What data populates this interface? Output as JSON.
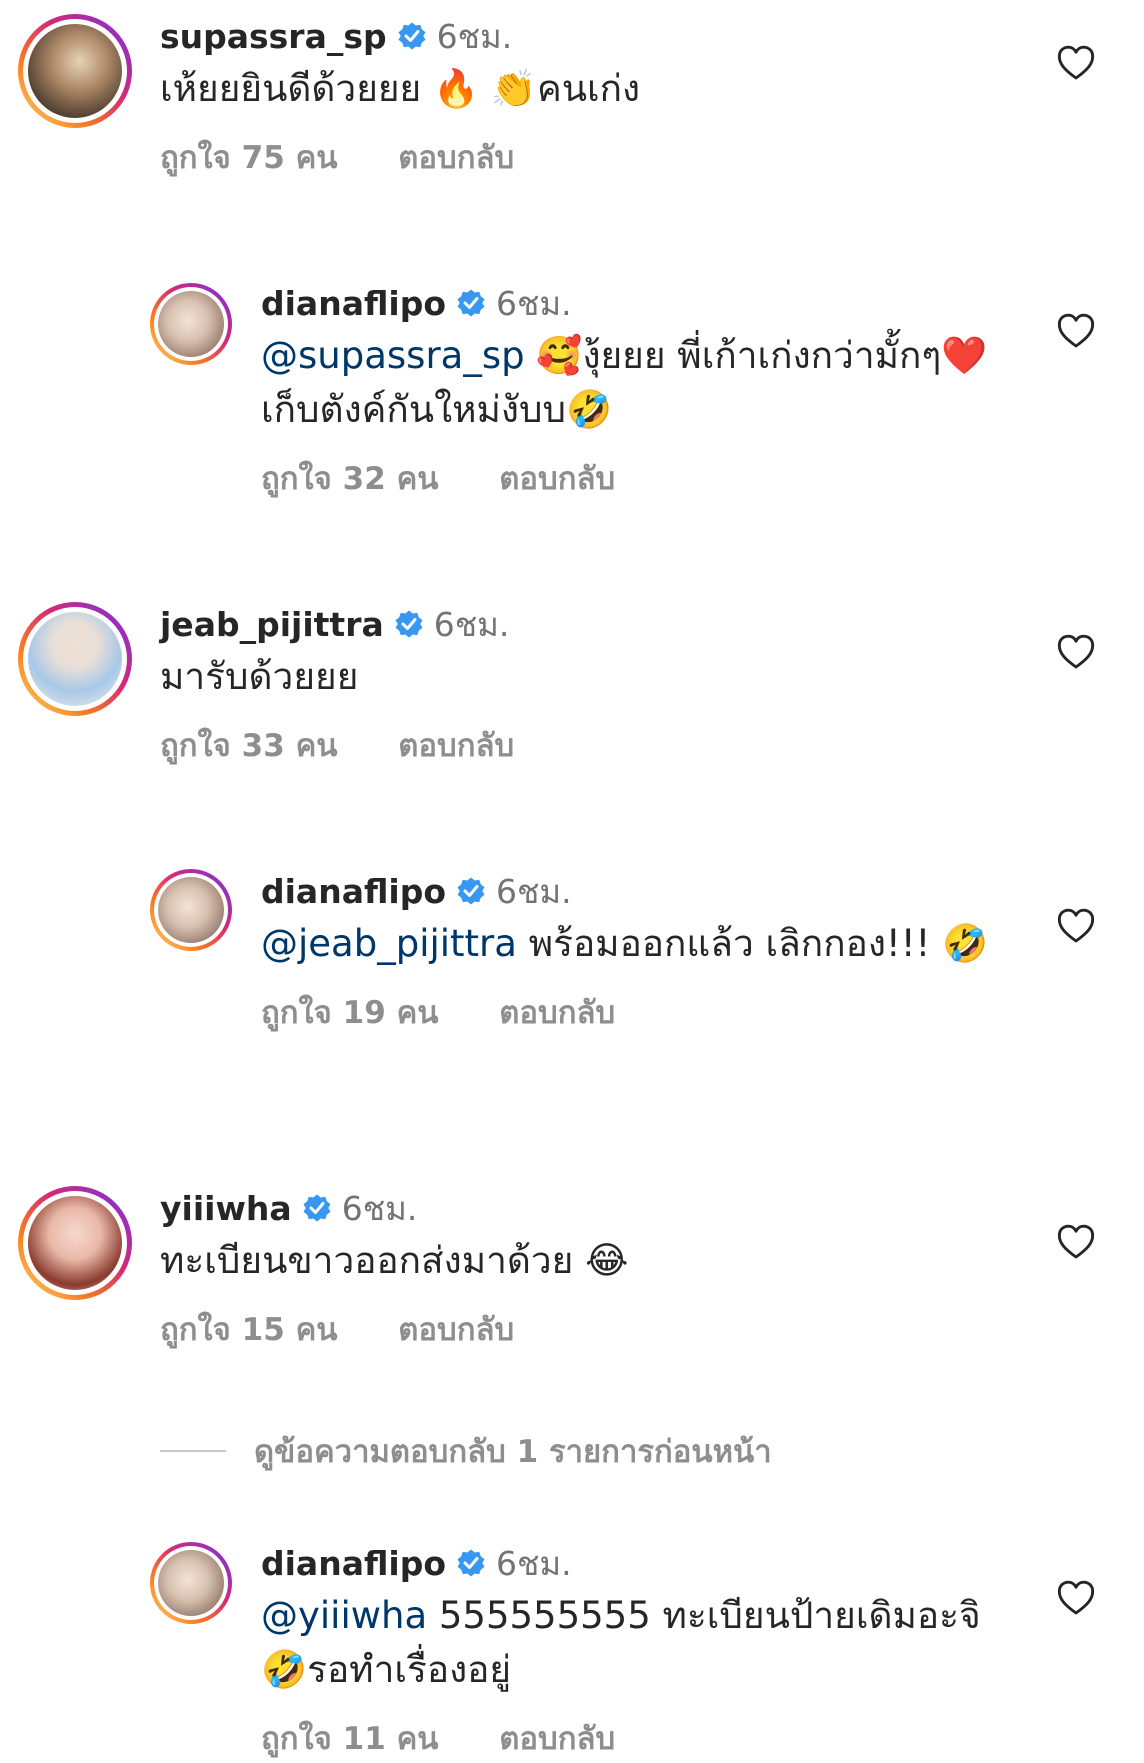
{
  "comments": [
    {
      "username": "supassra_sp",
      "time": "6ชม.",
      "text_before": "เห้ยยยินดีด้วยยย",
      "emoji1": "🔥",
      "emoji2": "👏",
      "text_after": "คนเก่ง",
      "likes": "ถูกใจ 75 คน",
      "reply_label": "ตอบกลับ",
      "avatar_icon": "portrait-photo"
    },
    {
      "username": "dianaflipo",
      "time": "6ชม.",
      "mention": "@supassra_sp",
      "emoji1": "🥰",
      "text_mid": "งุ้ยยย พี่เก้าเก่งกว่ามั้กๆ",
      "emoji2": "❤️",
      "text_after": " เก็บตังค์กันใหม่งับบ",
      "emoji3": "🤣",
      "likes": "ถูกใจ 32 คน",
      "reply_label": "ตอบกลับ",
      "avatar_icon": "portrait-photo"
    },
    {
      "username": "jeab_pijittra",
      "time": "6ชม.",
      "text": "มารับด้วยยย",
      "likes": "ถูกใจ 33 คน",
      "reply_label": "ตอบกลับ",
      "avatar_icon": "portrait-photo"
    },
    {
      "username": "dianaflipo",
      "time": "6ชม.",
      "mention": "@jeab_pijittra",
      "text_after": " พร้อมออกแล้ว เลิกกอง!!!",
      "emoji1": "🤣",
      "likes": "ถูกใจ 19 คน",
      "reply_label": "ตอบกลับ",
      "avatar_icon": "portrait-photo"
    },
    {
      "username": "yiiiwha",
      "time": "6ชม.",
      "text": "ทะเบียนขาวออกส่งมาด้วย ",
      "emoji1": "😂",
      "likes": "ถูกใจ 15 คน",
      "reply_label": "ตอบกลับ",
      "avatar_icon": "portrait-photo"
    },
    {
      "username": "dianaflipo",
      "time": "6ชม.",
      "mention": "@yiiiwha",
      "text_mid": " 555555555 ทะเบียนป้ายเดิมอะจิ",
      "emoji1": "🤣",
      "text_after": "รอทำเรื่องอยู่",
      "likes": "ถูกใจ 11 คน",
      "reply_label": "ตอบกลับ",
      "avatar_icon": "portrait-photo"
    }
  ],
  "view_previous_replies": "ดูข้อความตอบกลับ 1 รายการก่อนหน้า",
  "icons": {
    "verified": "verified-badge-icon",
    "like": "heart-outline-icon"
  },
  "colors": {
    "mention": "#00376b",
    "verified": "#3897f0",
    "secondary_text": "#8e8e8e"
  }
}
